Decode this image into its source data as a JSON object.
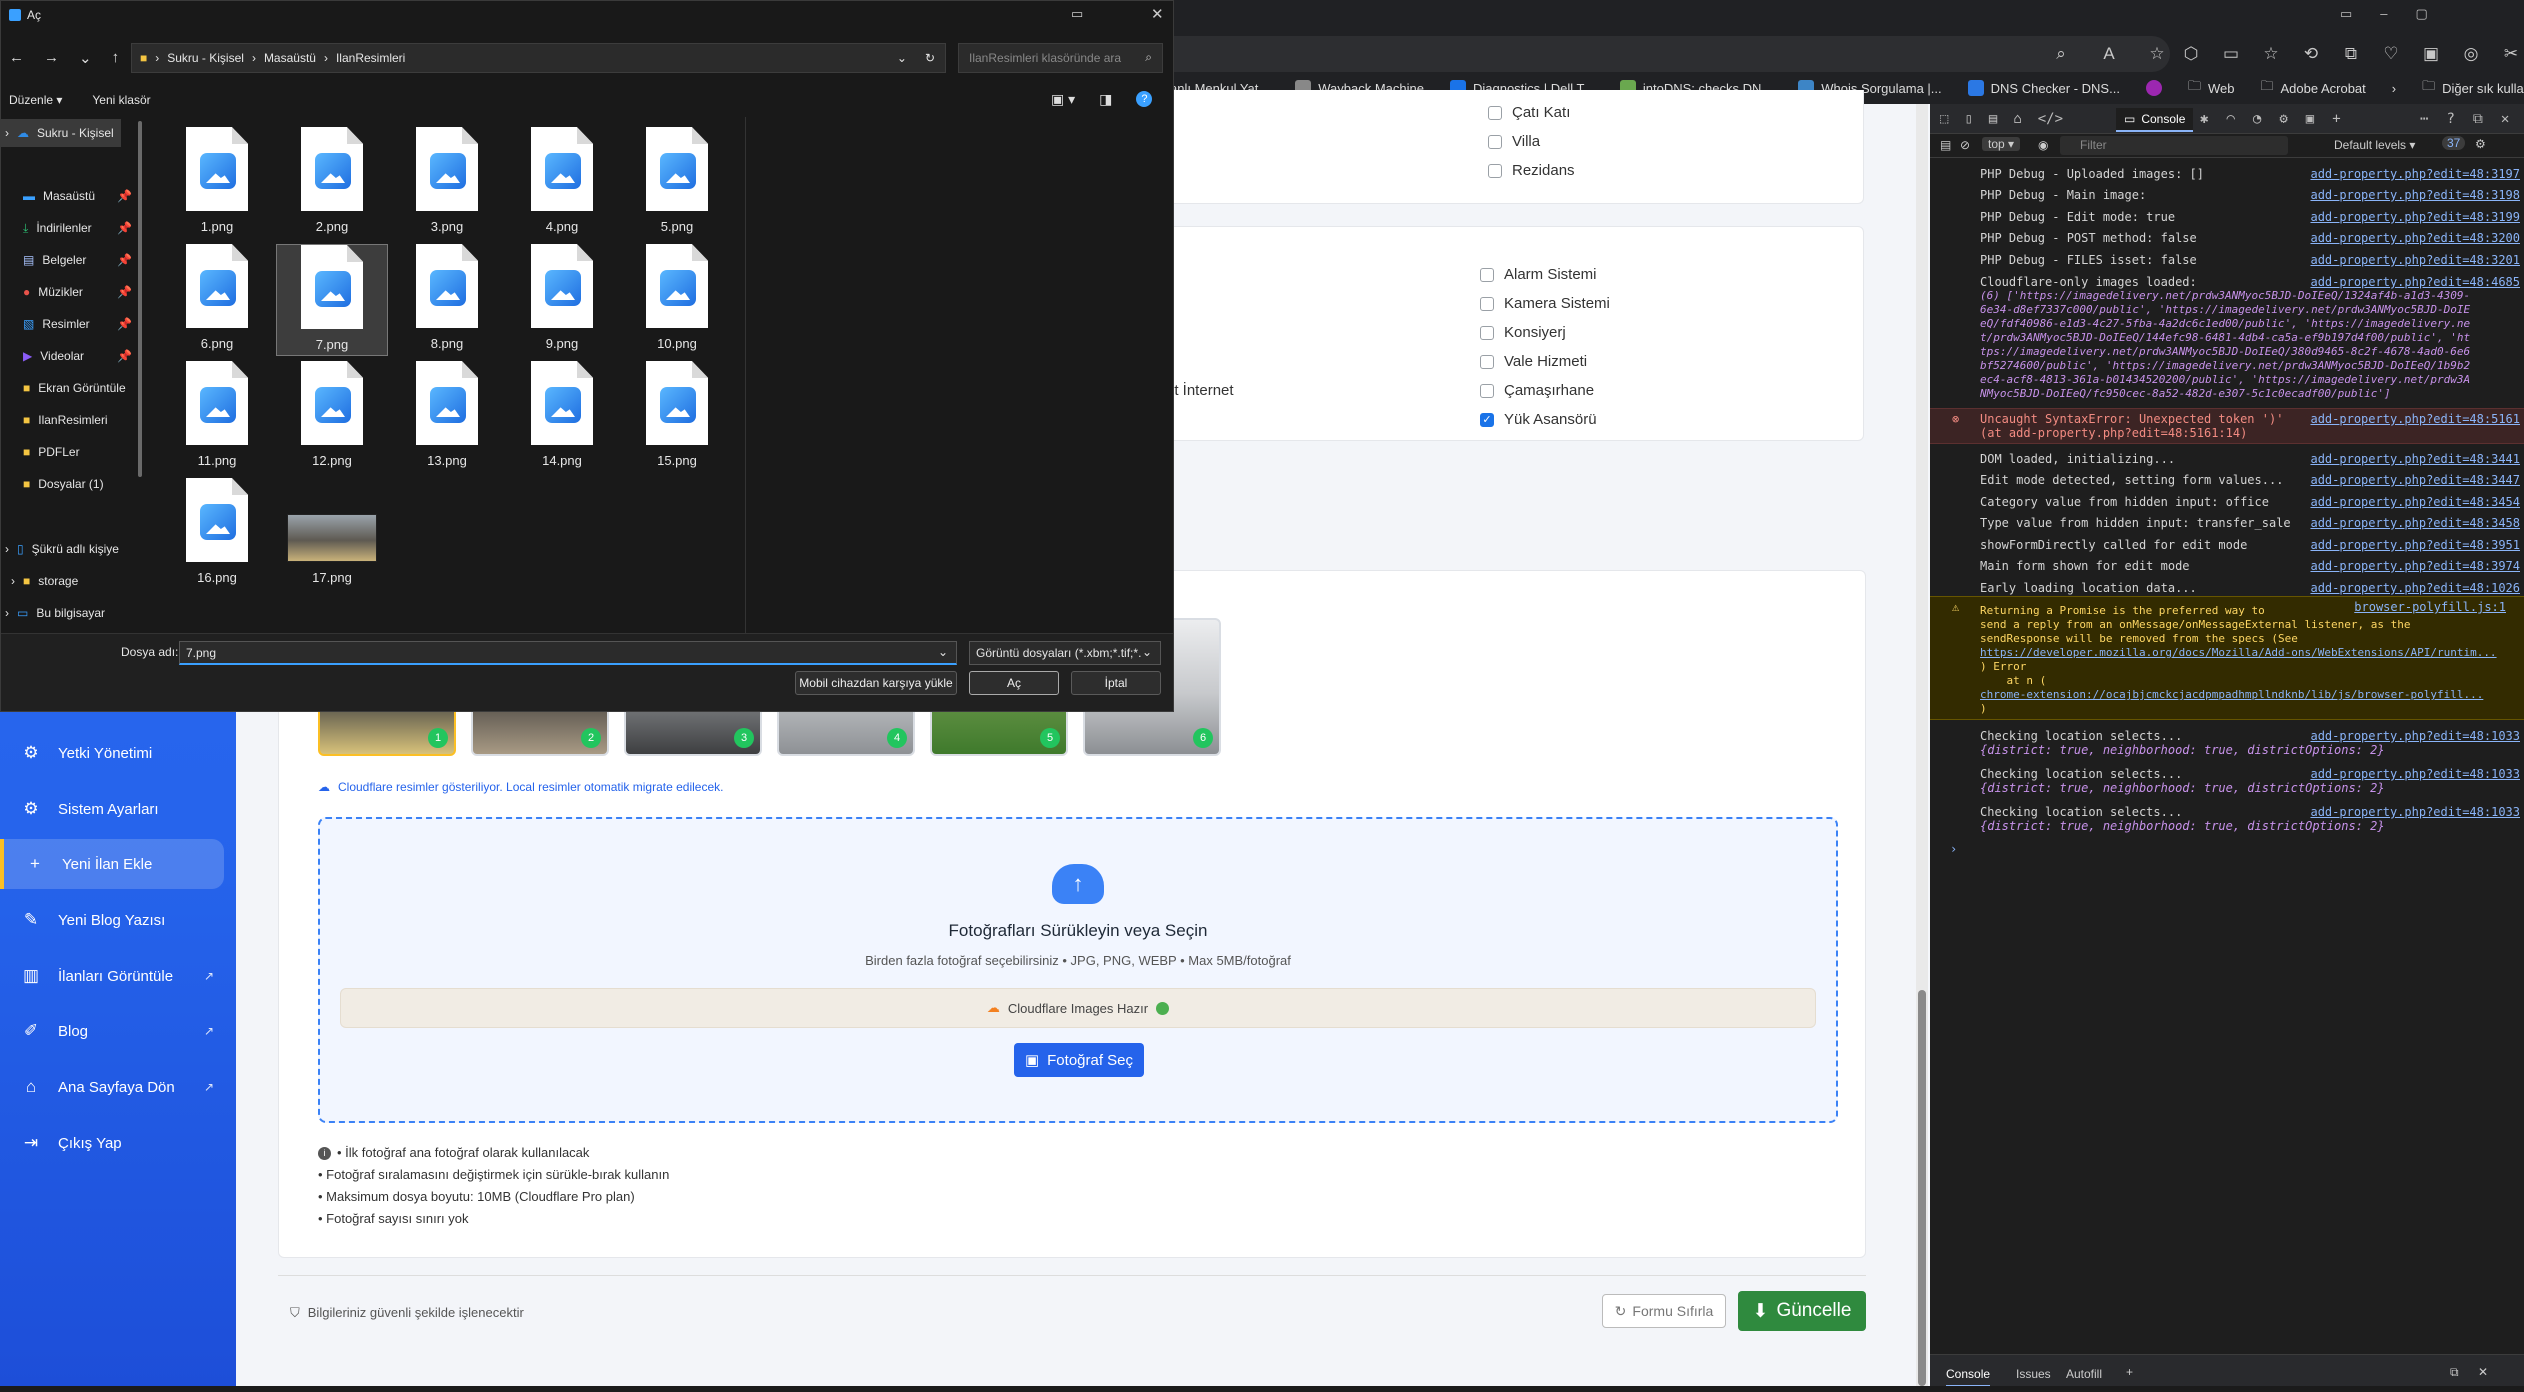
{
  "browser": {
    "bookmarks": [
      "anlı Menkul Yat...",
      "Wayback Machine",
      "Diagnostics | Dell T...",
      "intoDNS: checks DN...",
      "Whois Sorgulama |...",
      "DNS Checker - DNS...",
      "Web",
      "Adobe Acrobat"
    ],
    "bookmarks_more": "Diğer sık kullanılanlar"
  },
  "sidebar": {
    "items": [
      {
        "label": "Yetki Yönetimi",
        "icon": "users-gear-icon"
      },
      {
        "label": "Sistem Ayarları",
        "icon": "gear-icon"
      },
      {
        "label": "Yeni İlan Ekle",
        "icon": "plus-icon"
      },
      {
        "label": "Yeni Blog Yazısı",
        "icon": "edit-icon"
      },
      {
        "label": "İlanları Görüntüle",
        "icon": "building-icon"
      },
      {
        "label": "Blog",
        "icon": "blog-icon"
      },
      {
        "label": "Ana Sayfaya Dön",
        "icon": "home-icon"
      },
      {
        "label": "Çıkış Yap",
        "icon": "logout-icon"
      }
    ]
  },
  "form": {
    "type_options": [
      "Çatı Katı",
      "Villa",
      "Rezidans"
    ],
    "type_partial_left": [
      "l",
      "ı"
    ],
    "features": [
      {
        "label": "Alarm Sistemi",
        "checked": false
      },
      {
        "label": "Kamera Sistemi",
        "checked": false
      },
      {
        "label": "Konsiyerj",
        "checked": false
      },
      {
        "label": "Vale Hizmeti",
        "checked": false
      },
      {
        "label": "Çamaşırhane",
        "checked": false
      },
      {
        "label": "Yük Asansörü",
        "checked": true
      }
    ],
    "partial_feature": "nt İnternet",
    "thumbs": [
      "1",
      "2",
      "3",
      "4",
      "5",
      "6"
    ],
    "cloudflare_note": "Cloudflare resimler gösteriliyor. Local resimler otomatik migrate edilecek.",
    "upload_title": "Fotoğrafları Sürükleyin veya Seçin",
    "upload_sub": "Birden fazla fotoğraf seçebilirsiniz • JPG, PNG, WEBP • Max 5MB/fotoğraf",
    "cf_ready": "Cloudflare Images Hazır",
    "choose_btn": "Fotoğraf Seç",
    "tips": [
      "• İlk fotoğraf ana fotoğraf olarak kullanılacak",
      "• Fotoğraf sıralamasını değiştirmek için sürükle-bırak kullanın",
      "• Maksimum dosya boyutu: 10MB (Cloudflare Pro plan)",
      "• Fotoğraf sayısı sınırı yok"
    ],
    "secure_note": "Bilgileriniz güvenli şekilde işlenecektir",
    "reset_btn": "Formu Sıfırla",
    "update_btn": "Güncelle"
  },
  "devtools": {
    "tab": "Console",
    "context": "top",
    "filter_placeholder": "Filter",
    "levels": "Default levels",
    "count": "37",
    "lines": [
      {
        "text": "PHP Debug - Uploaded images: []",
        "src": "add-property.php?edit=48:3197"
      },
      {
        "text": "PHP Debug - Main image:",
        "src": "add-property.php?edit=48:3198"
      },
      {
        "text": "PHP Debug - Edit mode: true",
        "src": "add-property.php?edit=48:3199"
      },
      {
        "text": "PHP Debug - POST method: false",
        "src": "add-property.php?edit=48:3200"
      },
      {
        "text": "PHP Debug - FILES isset: false",
        "src": "add-property.php?edit=48:3201"
      },
      {
        "text": "Cloudflare-only images loaded:",
        "src": "add-property.php?edit=48:4685"
      }
    ],
    "cf_urls": [
      "(6) ['https://imagedelivery.net/prdw3ANMyoc5BJD-DoIEeQ/1324af4b-a1d3-4309-",
      "6e34-d8ef7337c000/public', 'https://imagedelivery.net/prdw3ANMyoc5BJD-DoIE",
      "eQ/fdf40986-e1d3-4c27-5fba-4a2dc6c1ed00/public', 'https://imagedelivery.ne",
      "t/prdw3ANMyoc5BJD-DoIEeQ/144efc98-6481-4db4-ca5a-ef9b197d4f00/public', 'ht",
      "tps://imagedelivery.net/prdw3ANMyoc5BJD-DoIEeQ/380d9465-8c2f-4678-4ad0-6e6",
      "bf5274600/public', 'https://imagedelivery.net/prdw3ANMyoc5BJD-DoIEeQ/1b9b2",
      "ec4-acf8-4813-361a-b01434520200/public', 'https://imagedelivery.net/prdw3A",
      "NMyoc5BJD-DoIEeQ/fc950cec-8a52-482d-e307-5c1c0ecadf00/public']"
    ],
    "error_text": "Uncaught SyntaxError: Unexpected token ')'",
    "error_src": "add-property.php?edit=48:5161",
    "error_at": "(at add-property.php?edit=48:5161:14)",
    "lines2": [
      {
        "text": "DOM loaded, initializing...",
        "src": "add-property.php?edit=48:3441"
      },
      {
        "text": "Edit mode detected, setting form values...",
        "src": "add-property.php?edit=48:3447"
      },
      {
        "text": "Category value from hidden input: office",
        "src": "add-property.php?edit=48:3454"
      },
      {
        "text": "Type value from hidden input: transfer_sale",
        "src": "add-property.php?edit=48:3458"
      },
      {
        "text": "showFormDirectly called for edit mode",
        "src": "add-property.php?edit=48:3951"
      },
      {
        "text": "Main form shown for edit mode",
        "src": "add-property.php?edit=48:3974"
      },
      {
        "text": "Early loading location data...",
        "src": "add-property.php?edit=48:1026"
      }
    ],
    "warn_src": "browser-polyfill.js:1",
    "warn_lines": [
      "Returning a Promise is the preferred way to",
      "send a reply from an onMessage/onMessageExternal listener, as the",
      "sendResponse will be removed from the specs (See",
      "https://developer.mozilla.org/docs/Mozilla/Add-ons/WebExtensions/API/runtim...",
      ") Error",
      "    at n (",
      "chrome-extension://ocajbjcmckcjacdpmpadhmpllndknb/lib/js/browser-polyfill...",
      ")"
    ],
    "checks": [
      {
        "text": "Checking location selects...",
        "src": "add-property.php?edit=48:1033",
        "obj": "{district: true, neighborhood: true, districtOptions: 2}"
      },
      {
        "text": "Checking location selects...",
        "src": "add-property.php?edit=48:1033",
        "obj": "{district: true, neighborhood: true, districtOptions: 2}"
      },
      {
        "text": "Checking location selects...",
        "src": "add-property.php?edit=48:1033",
        "obj": "{district: true, neighborhood: true, districtOptions: 2}"
      }
    ],
    "bottom_tabs": [
      "Console",
      "Issues",
      "Autofill"
    ]
  },
  "dialog": {
    "title": "Aç",
    "breadcrumb": [
      "Sukru - Kişisel",
      "Masaüstü",
      "IlanResimleri"
    ],
    "search_placeholder": "IlanResimleri klasöründe ara",
    "organize": "Düzenle",
    "new_folder": "Yeni klasör",
    "tree": [
      {
        "label": "Sukru - Kişisel",
        "icon": "cloud-icon",
        "color": "#2f8be6"
      },
      {
        "label": "Masaüstü",
        "icon": "desktop-icon",
        "color": "#3aa0ff",
        "pin": true
      },
      {
        "label": "İndirilenler",
        "icon": "download-icon",
        "color": "#2dbd73",
        "pin": true
      },
      {
        "label": "Belgeler",
        "icon": "document-icon",
        "color": "#a9c4ff",
        "pin": true
      },
      {
        "label": "Müzikler",
        "icon": "music-icon",
        "color": "#e8534a",
        "pin": true
      },
      {
        "label": "Resimler",
        "icon": "pictures-icon",
        "color": "#3aa0ff",
        "pin": true
      },
      {
        "label": "Videolar",
        "icon": "video-icon",
        "color": "#8a5cf6",
        "pin": true
      },
      {
        "label": "Ekran Görüntüle",
        "icon": "folder-icon",
        "color": "#f4c542"
      },
      {
        "label": "IlanResimleri",
        "icon": "folder-icon",
        "color": "#f4c542"
      },
      {
        "label": "PDFLer",
        "icon": "folder-icon",
        "color": "#f4c542"
      },
      {
        "label": "Dosyalar (1)",
        "icon": "folder-icon",
        "color": "#f4c542"
      },
      {
        "label": "Şükrü adlı kişiye",
        "icon": "phone-icon",
        "color": "#3aa0ff"
      },
      {
        "label": "storage",
        "icon": "folder-icon",
        "color": "#f4c542"
      },
      {
        "label": "Bu bilgisayar",
        "icon": "computer-icon",
        "color": "#3aa0ff"
      }
    ],
    "files": [
      "1.png",
      "2.png",
      "3.png",
      "4.png",
      "5.png",
      "6.png",
      "7.png",
      "8.png",
      "9.png",
      "10.png",
      "11.png",
      "12.png",
      "13.png",
      "14.png",
      "15.png",
      "16.png",
      "17.png"
    ],
    "selected_file": "7.png",
    "filename_label": "Dosya adı:",
    "filename_value": "7.png",
    "filetype": "Görüntü dosyaları (*.xbm;*.tif;*.",
    "mobile_btn": "Mobil cihazdan karşıya yükle",
    "open_btn": "Aç",
    "cancel_btn": "İptal"
  }
}
